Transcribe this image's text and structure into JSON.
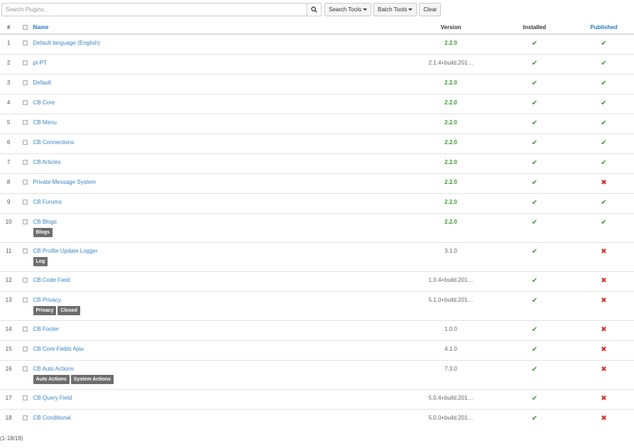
{
  "toolbar": {
    "search_placeholder": "Search Plugins...",
    "search_tools_label": "Search Tools",
    "batch_tools_label": "Batch Tools",
    "clear_label": "Clear"
  },
  "table": {
    "headers": {
      "num": "#",
      "name": "Name",
      "version": "Version",
      "installed": "Installed",
      "published": "Published"
    },
    "rows": [
      {
        "num": "1",
        "name": "Default language (English)",
        "version": "2.2.0",
        "version_ok": true,
        "installed": true,
        "published": true,
        "badges": []
      },
      {
        "num": "2",
        "name": "pt-PT",
        "version": "2.1.4+build.201…",
        "version_ok": false,
        "installed": true,
        "published": true,
        "badges": []
      },
      {
        "num": "3",
        "name": "Default",
        "version": "2.2.0",
        "version_ok": true,
        "installed": true,
        "published": true,
        "badges": []
      },
      {
        "num": "4",
        "name": "CB Core",
        "version": "2.2.0",
        "version_ok": true,
        "installed": true,
        "published": true,
        "badges": []
      },
      {
        "num": "5",
        "name": "CB Menu",
        "version": "2.2.0",
        "version_ok": true,
        "installed": true,
        "published": true,
        "badges": []
      },
      {
        "num": "6",
        "name": "CB Connections",
        "version": "2.2.0",
        "version_ok": true,
        "installed": true,
        "published": true,
        "badges": []
      },
      {
        "num": "7",
        "name": "CB Articles",
        "version": "2.2.0",
        "version_ok": true,
        "installed": true,
        "published": true,
        "badges": []
      },
      {
        "num": "8",
        "name": "Private Message System",
        "version": "2.2.0",
        "version_ok": true,
        "installed": true,
        "published": false,
        "badges": []
      },
      {
        "num": "9",
        "name": "CB Forums",
        "version": "2.2.0",
        "version_ok": true,
        "installed": true,
        "published": true,
        "badges": []
      },
      {
        "num": "10",
        "name": "CB Blogs",
        "version": "2.2.0",
        "version_ok": true,
        "installed": true,
        "published": true,
        "badges": [
          "Blogs"
        ]
      },
      {
        "num": "11",
        "name": "CB Profile Update Logger",
        "version": "3.1.0",
        "version_ok": false,
        "installed": true,
        "published": false,
        "badges": [
          "Log"
        ]
      },
      {
        "num": "12",
        "name": "CB Code Field",
        "version": "1.0.4+build.201…",
        "version_ok": false,
        "installed": true,
        "published": false,
        "badges": []
      },
      {
        "num": "13",
        "name": "CB Privacy",
        "version": "5.1.0+build.201…",
        "version_ok": false,
        "installed": true,
        "published": false,
        "badges": [
          "Privacy",
          "Closed"
        ]
      },
      {
        "num": "14",
        "name": "CB Footer",
        "version": "1.0.0",
        "version_ok": false,
        "installed": true,
        "published": false,
        "badges": []
      },
      {
        "num": "15",
        "name": "CB Core Fields Ajax",
        "version": "4.1.0",
        "version_ok": false,
        "installed": true,
        "published": false,
        "badges": []
      },
      {
        "num": "16",
        "name": "CB Auto Actions",
        "version": "7.3.0",
        "version_ok": false,
        "installed": true,
        "published": false,
        "badges": [
          "Auto Actions",
          "System Actions"
        ]
      },
      {
        "num": "17",
        "name": "CB Query Field",
        "version": "5.0.4+build.201…",
        "version_ok": false,
        "installed": true,
        "published": false,
        "badges": []
      },
      {
        "num": "18",
        "name": "CB Conditional",
        "version": "5.0.0+build.201…",
        "version_ok": false,
        "installed": true,
        "published": false,
        "badges": []
      }
    ]
  },
  "marks": {
    "yes": "✔",
    "no": "✖"
  },
  "colors": {
    "link": "#3b86c6",
    "ok": "#3f9c35",
    "no": "#d0312d",
    "badge": "#6e6e6e"
  },
  "footer": {
    "count": "(1-18/18)"
  }
}
